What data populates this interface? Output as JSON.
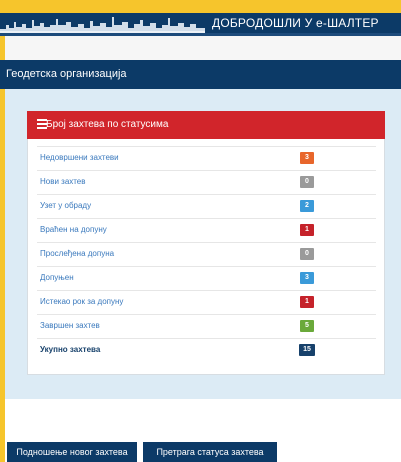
{
  "banner": {
    "title": "ДОБРОДОШЛИ У е-ШАЛТЕР",
    "image": "city-skyline-silhouette"
  },
  "organization": {
    "name": "Геодетска организација"
  },
  "status_panel": {
    "icon": "list-icon",
    "title": "Број захтева по статусима",
    "rows": [
      {
        "label": "Недовршени захтеви",
        "count": "3",
        "color": "#e8662b"
      },
      {
        "label": "Нови захтев",
        "count": "0",
        "color": "#9a9a9a"
      },
      {
        "label": "Узет у обраду",
        "count": "2",
        "color": "#3a9ad9"
      },
      {
        "label": "Враћен на допуну",
        "count": "1",
        "color": "#c5222a"
      },
      {
        "label": "Прослеђена допуна",
        "count": "0",
        "color": "#9a9a9a"
      },
      {
        "label": "Допуњен",
        "count": "3",
        "color": "#3a9ad9"
      },
      {
        "label": "Истекао рок за допуну",
        "count": "1",
        "color": "#c5222a"
      },
      {
        "label": "Завршен захтев",
        "count": "5",
        "color": "#6aa93a"
      },
      {
        "label": "Укупно захтева",
        "count": "15",
        "color": "#17416b"
      }
    ]
  },
  "actions": {
    "new_request": "Подношење новог захтева",
    "search_status": "Претрага статуса захтева"
  },
  "colors": {
    "navy": "#0c3a67",
    "panel_header_red": "#d1252b",
    "accent_yellow": "#f6c52c",
    "content_background": "#dcebf5"
  }
}
